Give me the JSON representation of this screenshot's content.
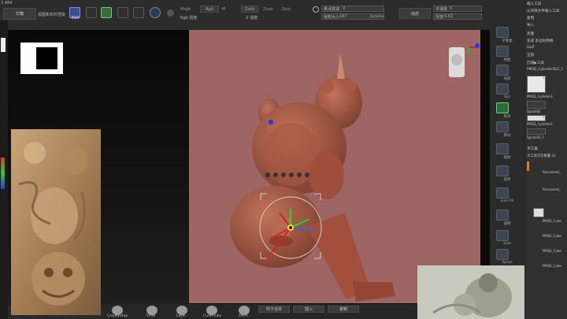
{
  "topbar": {
    "coord": "3.484",
    "left_btn": "灯箱",
    "subtitle": "视图和实时渲染",
    "mrgb": "Mrgb",
    "rgb": "Rgb",
    "m": "M",
    "rgb_intensity": "Rgb 强度",
    "zadd": "Zadd",
    "zsub": "Zsub",
    "zcut": "Zcut",
    "z_intensity": "Z 强度",
    "focal_label": "焦点衰减",
    "focal_value": "0",
    "draw_size_label": "绘制大小",
    "draw_size_value": "167",
    "dynamic": "Dynamic",
    "smooth": "动态",
    "smooth_label": "平滑度",
    "smooth_value": "5",
    "thickness_label": "厚度",
    "thickness_value": "0.02"
  },
  "toolbar_icons": [
    {
      "icon": "edit-icon",
      "label": "Edit"
    },
    {
      "icon": "draw-icon",
      "label": "绘制"
    },
    {
      "icon": "move-icon",
      "label": "移动"
    },
    {
      "icon": "scale-icon",
      "label": "缩放"
    },
    {
      "icon": "rotate-icon",
      "label": "旋转"
    },
    {
      "icon": "sphere-icon",
      "label": ""
    },
    {
      "icon": "gizmo-icon",
      "label": ""
    }
  ],
  "viewport": {
    "background": "#9d6563",
    "navigation_head": "head-navigator-icon"
  },
  "right_dock": [
    {
      "icon": "persp-icon",
      "label": "子像素"
    },
    {
      "icon": "floor-icon",
      "label": "地面"
    },
    {
      "icon": "local-icon",
      "label": "局部"
    },
    {
      "icon": "xyz-icon",
      "label": "Xyz"
    },
    {
      "icon": "frame-icon",
      "label": "框架"
    },
    {
      "icon": "move-view-icon",
      "label": "移动"
    },
    {
      "icon": "zoom-icon",
      "label": "缩放"
    },
    {
      "icon": "rotate-view-icon",
      "label": "旋转"
    },
    {
      "icon": "linefill-icon",
      "label": "Line Fill"
    },
    {
      "icon": "transp-icon",
      "label": "透明"
    },
    {
      "icon": "solo-icon",
      "label": "Solo"
    },
    {
      "icon": "xpose-icon",
      "label": "Xpose"
    }
  ],
  "right_panel": {
    "top_items": [
      "载入工具",
      "从项目文件载入工具",
      "复制",
      "导入",
      "克隆",
      "生成 多边形网格",
      "GoZ",
      "全部",
      "灯箱▶工具"
    ],
    "current_tool": "PM3D_Cylinder3D2_1",
    "tool_thumbs": [
      {
        "name": "PM3D_Cylinder3",
        "count": "17"
      },
      {
        "name": "SpiralSD",
        "count": ""
      },
      {
        "name": "PM3D_Cylinder3",
        "count": "17"
      },
      {
        "name": "Spiral3D_1",
        "count": ""
      }
    ],
    "subtool_header": "子工具",
    "subtool_count": "子工具可见数量 21",
    "subtools": [
      "Recovered_",
      "Recovered_",
      "PM3D_Cube",
      "PM3D_Cube",
      "PM3D_Cube",
      "PM3D_Cube"
    ]
  },
  "bottom_brushes": [
    {
      "label": "ClayBuildup"
    },
    {
      "label": "Inflat"
    },
    {
      "label": "Layer"
    },
    {
      "label": "CurveTube"
    },
    {
      "label": "Pinch"
    }
  ],
  "bottom_fields": {
    "field1": "向下合并",
    "field2": "插入",
    "field3": "复制"
  }
}
